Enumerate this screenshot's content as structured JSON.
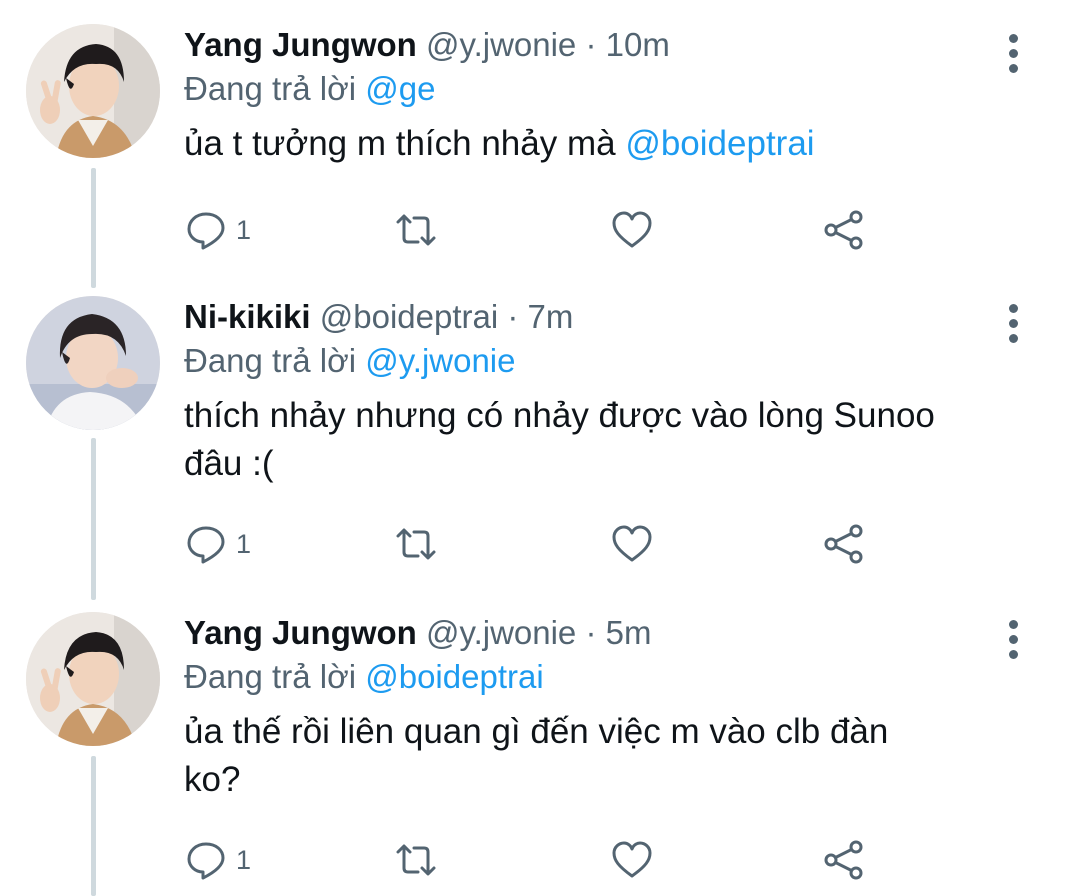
{
  "colors": {
    "accent": "#1d9bf0",
    "secondary_text": "#536471",
    "thread_line": "#cfd9de"
  },
  "tweets": [
    {
      "name": "Yang Jungwon",
      "handle": "@y.jwonie",
      "separator": "·",
      "time": "10m",
      "replying_label": "Đang trả lời",
      "replying_to": "@ge",
      "text_parts": [
        "ủa t tưởng m thích nhảy mà ",
        "@boideptrai"
      ],
      "reply_count": "1",
      "avatar": "avatar-jungwon"
    },
    {
      "name": "Ni-kikiki",
      "handle": "@boideptrai",
      "separator": "·",
      "time": "7m",
      "replying_label": "Đang trả lời",
      "replying_to": "@y.jwonie",
      "text_lines": [
        "thích nhảy nhưng có nhảy được vào lòng Sunoo",
        "đâu :("
      ],
      "reply_count": "1",
      "avatar": "avatar-nikikiki"
    },
    {
      "name": "Yang Jungwon",
      "handle": "@y.jwonie",
      "separator": "·",
      "time": "5m",
      "replying_label": "Đang trả lời",
      "replying_to": "@boideptrai",
      "text_lines": [
        "ủa thế rồi liên quan gì đến việc m vào clb đàn",
        "ko?"
      ],
      "reply_count": "1",
      "avatar": "avatar-jungwon"
    }
  ],
  "icons": [
    "reply-icon",
    "retweet-icon",
    "like-icon",
    "share-icon",
    "more-options-icon"
  ]
}
